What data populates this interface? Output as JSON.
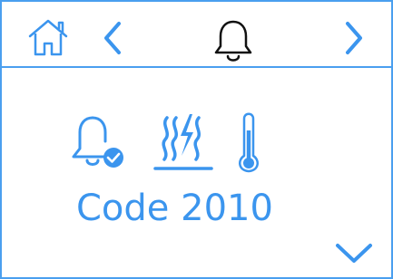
{
  "topbar": {
    "home_icon": "home-outline-icon",
    "prev_icon": "chevron-left-icon",
    "center_icon": "bell-outline-icon",
    "next_icon": "chevron-right-icon"
  },
  "main": {
    "status_icons": [
      "bell-check-icon",
      "heating-element-icon",
      "thermometer-icon"
    ],
    "code_text": "Code 2010",
    "down_icon": "chevron-down-icon"
  },
  "colors": {
    "accent": "#3b95ee",
    "border": "#4a9fef",
    "dark": "#111111",
    "background": "#ffffff"
  }
}
